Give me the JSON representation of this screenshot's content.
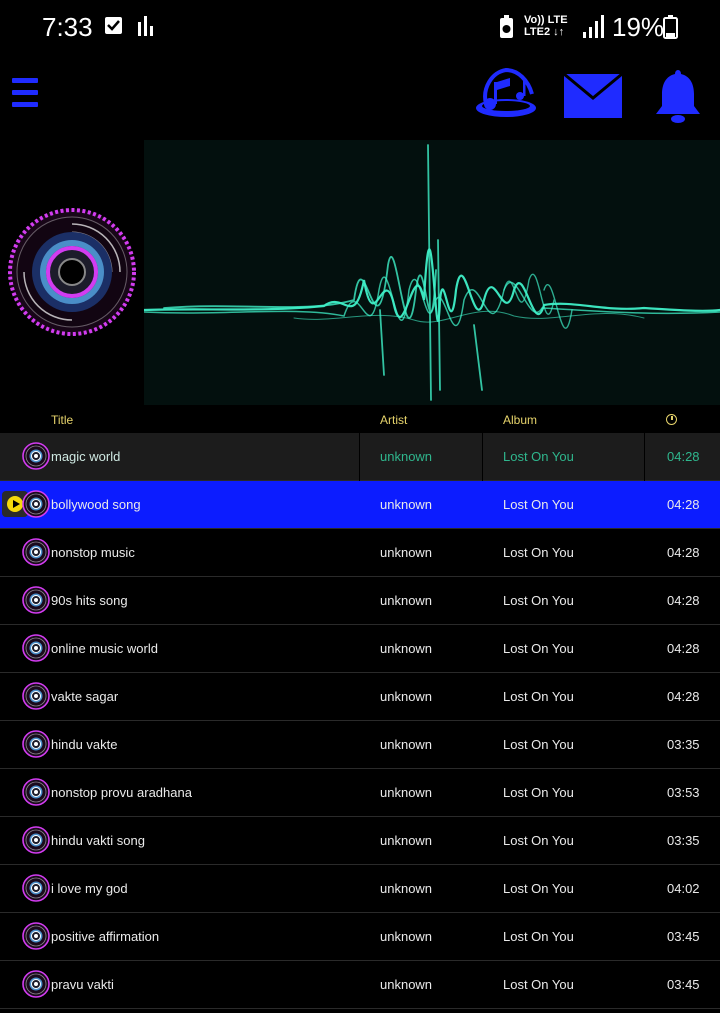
{
  "status_bar": {
    "time": "7:33",
    "network_top": "Vo)) LTE",
    "network_bottom": "LTE2 ↓↑",
    "battery": "19%",
    "icons": [
      "check-box-icon",
      "equalizer-icon",
      "battery-saver-icon",
      "signal-icon",
      "battery-icon"
    ]
  },
  "app_bar": {
    "icons": [
      "menu-icon",
      "music-logo-icon",
      "mail-icon",
      "bell-icon"
    ],
    "accent": "#1f2bff"
  },
  "columns": {
    "title": "Title",
    "artist": "Artist",
    "album": "Album",
    "duration_icon": "clock-icon"
  },
  "songs": [
    {
      "title": "magic world",
      "artist": "unknown",
      "album": "Lost On You",
      "duration": "04:28",
      "state": "selected"
    },
    {
      "title": "bollywood song",
      "artist": "unknown",
      "album": "Lost On You",
      "duration": "04:28",
      "state": "playing"
    },
    {
      "title": "nonstop music",
      "artist": "unknown",
      "album": "Lost On You",
      "duration": "04:28",
      "state": ""
    },
    {
      "title": "90s hits song",
      "artist": "unknown",
      "album": "Lost On You",
      "duration": "04:28",
      "state": ""
    },
    {
      "title": "online music world",
      "artist": "unknown",
      "album": "Lost On You",
      "duration": "04:28",
      "state": ""
    },
    {
      "title": "vakte sagar",
      "artist": "unknown",
      "album": "Lost On You",
      "duration": "04:28",
      "state": ""
    },
    {
      "title": "hindu vakte",
      "artist": "unknown",
      "album": "Lost On You",
      "duration": "03:35",
      "state": ""
    },
    {
      "title": "nonstop provu aradhana",
      "artist": "unknown",
      "album": "Lost On You",
      "duration": "03:53",
      "state": ""
    },
    {
      "title": "hindu vakti song",
      "artist": "unknown",
      "album": "Lost On You",
      "duration": "03:35",
      "state": ""
    },
    {
      "title": "i love my god",
      "artist": "unknown",
      "album": "Lost On You",
      "duration": "04:02",
      "state": ""
    },
    {
      "title": "positive affirmation",
      "artist": "unknown",
      "album": "Lost On You",
      "duration": "03:45",
      "state": ""
    },
    {
      "title": "pravu vakti",
      "artist": "unknown",
      "album": "Lost On You",
      "duration": "03:45",
      "state": ""
    }
  ],
  "colors": {
    "playing_row": "#0c1cff",
    "header_text": "#e6d36b",
    "selected_text": "#2fb68d",
    "waveform": "#3ff0c8",
    "disc_ring": "#d23cf0"
  }
}
